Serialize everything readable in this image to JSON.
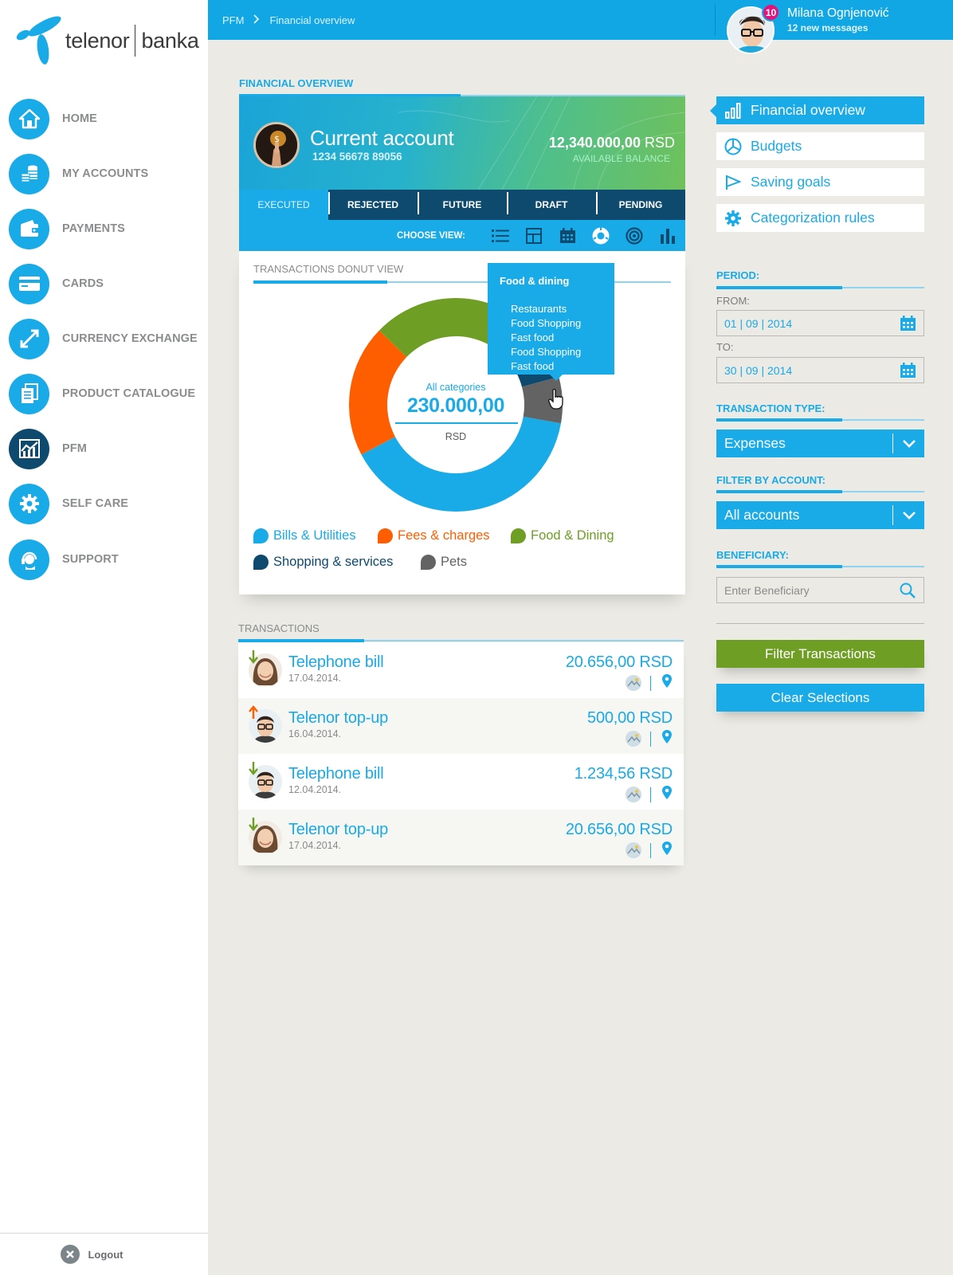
{
  "brand": {
    "name_left": "telenor",
    "name_right": "banka"
  },
  "nav": {
    "items": [
      {
        "label": "HOME",
        "icon": "home-icon"
      },
      {
        "label": "MY ACCOUNTS",
        "icon": "coins-icon"
      },
      {
        "label": "PAYMENTS",
        "icon": "wallet-icon"
      },
      {
        "label": "CARDS",
        "icon": "card-icon"
      },
      {
        "label": "CURRENCY EXCHANGE",
        "icon": "exchange-icon"
      },
      {
        "label": "PRODUCT CATALOGUE",
        "icon": "catalogue-icon"
      },
      {
        "label": "PFM",
        "icon": "chart-icon",
        "active": true
      },
      {
        "label": "SELF CARE",
        "icon": "gear-icon"
      },
      {
        "label": "SUPPORT",
        "icon": "support-icon"
      }
    ],
    "logout": "Logout"
  },
  "breadcrumb": {
    "root": "PFM",
    "current": "Financial overview"
  },
  "user": {
    "name": "Milana Ognjenović",
    "messages": "12 new messages",
    "badge": "10"
  },
  "overview": {
    "section_title": "FINANCIAL OVERVIEW",
    "account": {
      "title": "Current account",
      "number": "1234 56678 89056",
      "balance": "12,340.000,00",
      "currency": "RSD",
      "balance_label": "AVAILABLE BALANCE"
    },
    "tabs": [
      "EXECUTED",
      "REJECTED",
      "FUTURE",
      "DRAFT",
      "PENDING"
    ],
    "active_tab": "EXECUTED",
    "choose_view": "CHOOSE VIEW:",
    "views": [
      "list-view-icon",
      "grid-view-icon",
      "calendar-view-icon",
      "donut-view-icon",
      "target-view-icon",
      "bar-view-icon"
    ]
  },
  "donut": {
    "section_title": "TRANSACTIONS DONUT VIEW",
    "center_label": "All categories",
    "center_value": "230.000,00",
    "center_currency": "RSD",
    "tooltip": {
      "title": "Food & dining",
      "items": [
        "Restaurants",
        "Food Shopping",
        "Fast food",
        "Food Shopping",
        "Fast food"
      ]
    },
    "segments": [
      {
        "name": "Bills & Utilities",
        "value": 0.395,
        "color": "#19aae8"
      },
      {
        "name": "Fees & charges",
        "value": 0.2,
        "color": "#ff5e00"
      },
      {
        "name": "Food & Dining",
        "value": 0.265,
        "color": "#6f9e24"
      },
      {
        "name": "Shopping & services",
        "value": 0.07,
        "color": "#0e4a6e"
      },
      {
        "name": "Pets",
        "value": 0.07,
        "color": "#636363"
      }
    ],
    "legend": [
      {
        "name": "Bills & Utilities",
        "color": "#19aae8"
      },
      {
        "name": "Fees & charges",
        "color": "#ff5e00"
      },
      {
        "name": "Food & Dining",
        "color": "#6f9e24"
      },
      {
        "name": "Shopping & services",
        "color": "#0e4a6e"
      },
      {
        "name": "Pets",
        "color": "#636363"
      }
    ]
  },
  "transactions": {
    "section_title": "TRANSACTIONS",
    "rows": [
      {
        "name": "Telephone bill",
        "date": "17.04.2014.",
        "amount": "20.656,00 RSD",
        "direction": "in",
        "avatar": "woman"
      },
      {
        "name": "Telenor top-up",
        "date": "16.04.2014.",
        "amount": "500,00 RSD",
        "direction": "out",
        "avatar": "man"
      },
      {
        "name": "Telephone bill",
        "date": "12.04.2014.",
        "amount": "1.234,56 RSD",
        "direction": "in",
        "avatar": "man"
      },
      {
        "name": "Telenor top-up",
        "date": "17.04.2014.",
        "amount": "20.656,00 RSD",
        "direction": "in",
        "avatar": "woman"
      }
    ]
  },
  "right": {
    "menu": [
      {
        "label": "Financial overview",
        "icon": "bar-chart-icon",
        "active": true
      },
      {
        "label": "Budgets",
        "icon": "pie-chart-icon"
      },
      {
        "label": "Saving goals",
        "icon": "flag-icon"
      },
      {
        "label": "Categorization rules",
        "icon": "gear-icon"
      }
    ],
    "period_label": "PERIOD:",
    "from_label": "FROM:",
    "from_value": "01 | 09 | 2014",
    "to_label": "TO:",
    "to_value": "30 | 09 | 2014",
    "type_label": "TRANSACTION TYPE:",
    "type_value": "Expenses",
    "account_label": "FILTER BY ACCOUNT:",
    "account_value": "All accounts",
    "beneficiary_label": "BENEFICIARY:",
    "beneficiary_placeholder": "Enter Beneficiary",
    "filter_button": "Filter Transactions",
    "clear_button": "Clear Selections"
  }
}
